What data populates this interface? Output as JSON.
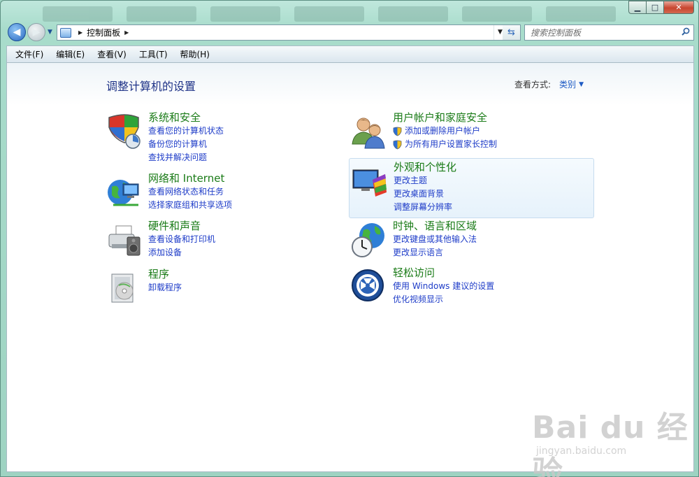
{
  "window": {
    "address_root": "控制面板",
    "search_placeholder": "搜索控制面板"
  },
  "caption": {
    "minimize": "▁",
    "maximize": "□",
    "close": "✕"
  },
  "menu": [
    "文件(F)",
    "编辑(E)",
    "查看(V)",
    "工具(T)",
    "帮助(H)"
  ],
  "page": {
    "title": "调整计算机的设置",
    "view_by_label": "查看方式:",
    "view_by_value": "类别"
  },
  "categories": {
    "system": {
      "title": "系统和安全",
      "links": [
        "查看您的计算机状态",
        "备份您的计算机",
        "查找并解决问题"
      ]
    },
    "network": {
      "title": "网络和 Internet",
      "links": [
        "查看网络状态和任务",
        "选择家庭组和共享选项"
      ]
    },
    "hardware": {
      "title": "硬件和声音",
      "links": [
        "查看设备和打印机",
        "添加设备"
      ]
    },
    "programs": {
      "title": "程序",
      "links": [
        "卸载程序"
      ]
    },
    "users": {
      "title": "用户帐户和家庭安全",
      "links": [
        "添加或删除用户帐户",
        "为所有用户设置家长控制"
      ]
    },
    "appearance": {
      "title": "外观和个性化",
      "links": [
        "更改主题",
        "更改桌面背景",
        "调整屏幕分辨率"
      ]
    },
    "clock": {
      "title": "时钟、语言和区域",
      "links": [
        "更改键盘或其他输入法",
        "更改显示语言"
      ]
    },
    "ease": {
      "title": "轻松访问",
      "links": [
        "使用 Windows 建议的设置",
        "优化视频显示"
      ]
    }
  },
  "watermark": {
    "brand": "Bai du 经验",
    "url": "jingyan.baidu.com"
  },
  "colors": {
    "title_blue": "#1e3287",
    "category_green": "#1a7b17",
    "link_blue": "#1e3cc8",
    "highlight_bg": "#e6f2fb"
  }
}
